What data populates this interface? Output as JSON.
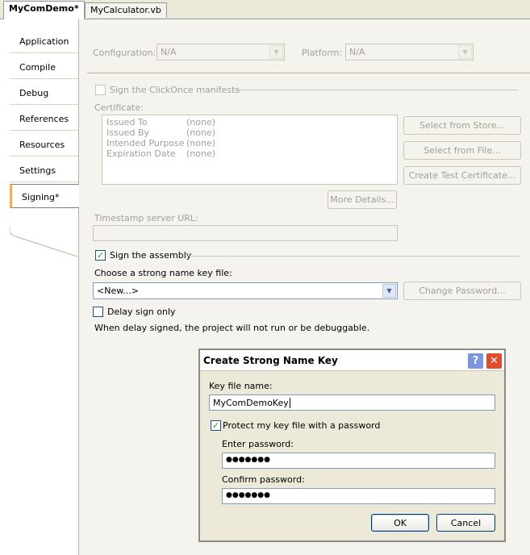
{
  "doc_tabs": [
    "MyComDemo*",
    "MyCalculator.vb"
  ],
  "side_tabs": [
    "Application",
    "Compile",
    "Debug",
    "References",
    "Resources",
    "Settings",
    "Signing*"
  ],
  "config": {
    "configuration_label": "Configuration:",
    "configuration_value": "N/A",
    "platform_label": "Platform:",
    "platform_value": "N/A"
  },
  "clickonce": {
    "sign_manifests_label": "Sign the ClickOnce manifests",
    "certificate_label": "Certificate:",
    "cert_rows": [
      {
        "key": "Issued To",
        "value": "(none)"
      },
      {
        "key": "Issued By",
        "value": "(none)"
      },
      {
        "key": "Intended Purpose",
        "value": "(none)"
      },
      {
        "key": "Expiration Date",
        "value": "(none)"
      }
    ],
    "select_store": "Select from Store...",
    "select_file": "Select from File...",
    "create_test": "Create Test Certificate...",
    "more_details": "More Details...",
    "timestamp_label": "Timestamp server URL:"
  },
  "assembly": {
    "sign_assembly_label": "Sign the assembly",
    "choose_key_label": "Choose a strong name key file:",
    "key_value": "<New...>",
    "change_password": "Change Password...",
    "delay_sign_label": "Delay sign only",
    "delay_note": "When delay signed, the project will not run or be debuggable."
  },
  "dialog": {
    "title": "Create Strong Name Key",
    "help": "?",
    "close": "✕",
    "key_file_label": "Key file name:",
    "key_file_value": "MyComDemoKey",
    "protect_label": "Protect my key file with a password",
    "enter_password_label": "Enter password:",
    "enter_password_value": "●●●●●●●",
    "confirm_password_label": "Confirm password:",
    "confirm_password_value": "●●●●●●●",
    "ok": "OK",
    "cancel": "Cancel"
  }
}
